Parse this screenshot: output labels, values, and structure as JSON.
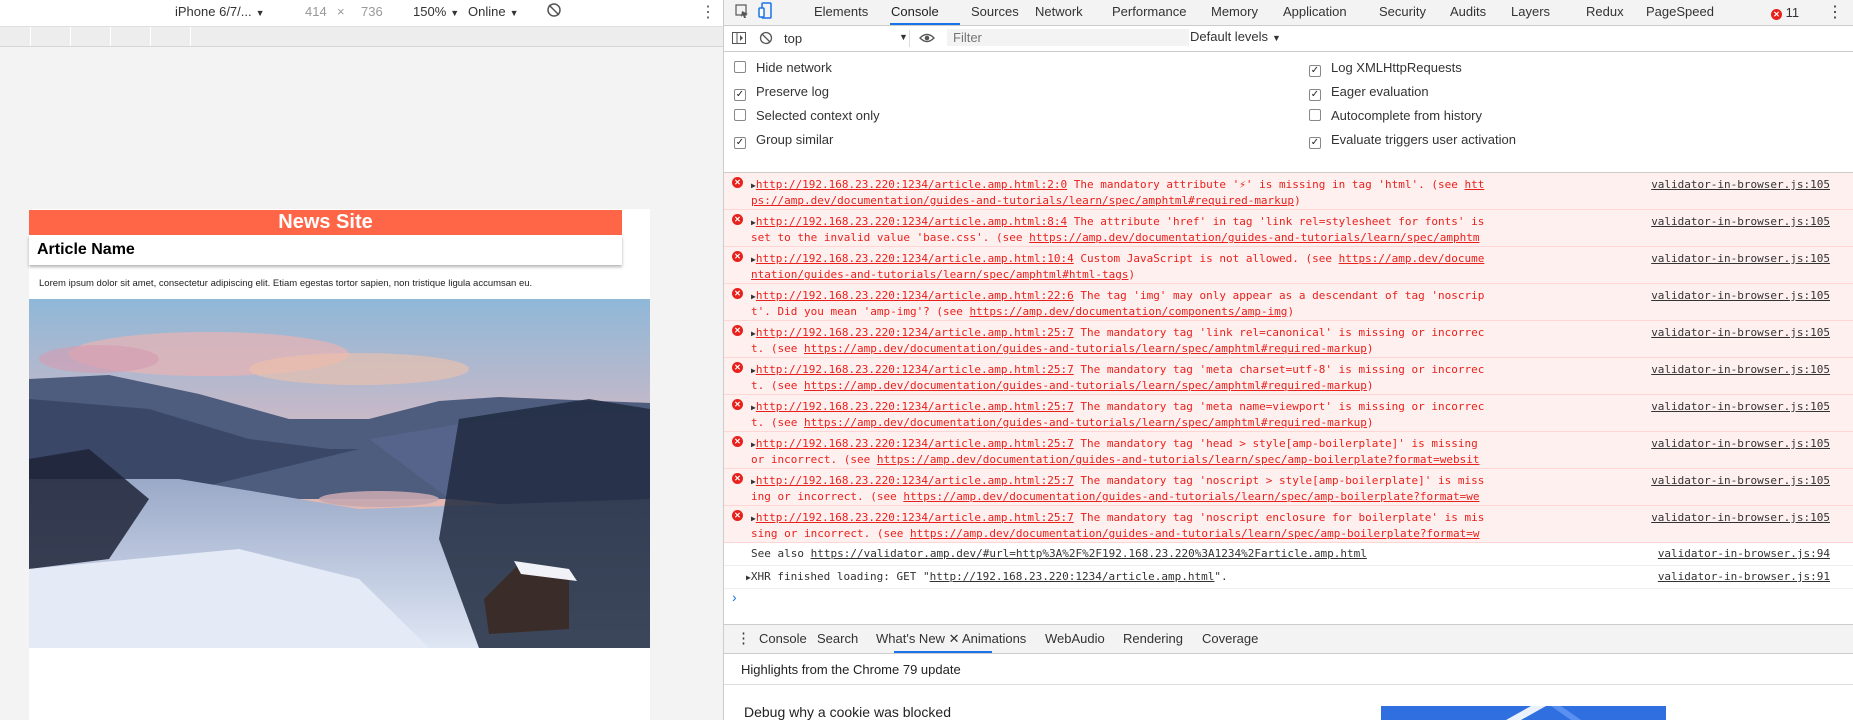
{
  "device_toolbar": {
    "device": "iPhone 6/7/...",
    "width": "414",
    "times": "×",
    "height": "736",
    "zoom": "150%",
    "network": "Online"
  },
  "page": {
    "site_title": "News Site",
    "article_name": "Article Name",
    "lorem": "Lorem ipsum dolor sit amet, consectetur adipiscing elit. Etiam egestas tortor sapien, non tristique ligula accumsan eu."
  },
  "devtools": {
    "tabs": [
      "Elements",
      "Console",
      "Sources",
      "Network",
      "Performance",
      "Memory",
      "Application",
      "Security",
      "Audits",
      "Layers",
      "Redux",
      "PageSpeed"
    ],
    "active_tab": "Console",
    "error_count": "11",
    "context": "top",
    "filter_placeholder": "Filter",
    "levels": "Default levels",
    "settings": [
      {
        "label": "Hide network",
        "checked": false
      },
      {
        "label": "Preserve log",
        "checked": true
      },
      {
        "label": "Selected context only",
        "checked": false
      },
      {
        "label": "Group similar",
        "checked": true
      },
      {
        "label": "Log XMLHttpRequests",
        "checked": true
      },
      {
        "label": "Eager evaluation",
        "checked": true
      },
      {
        "label": "Autocomplete from history",
        "checked": false
      },
      {
        "label": "Evaluate triggers user activation",
        "checked": true
      }
    ],
    "errors": [
      {
        "loc": "http://192.168.23.220:1234/article.amp.html:2:0",
        "text": " The mandatory attribute '⚡' is missing in tag 'html'. (see ",
        "url": "https://amp.dev/documentation/guides-and-tutorials/learn/spec/amphtml#required-markup",
        "end": ")",
        "src": "validator-in-browser.js:105"
      },
      {
        "loc": "http://192.168.23.220:1234/article.amp.html:8:4",
        "text": " The attribute 'href' in tag 'link rel=stylesheet for fonts' is set to the invalid value 'base.css'. (see ",
        "url": "https://amp.dev/documentation/guides-and-tutorials/learn/spec/amphtml#custom-fonts",
        "end": ")",
        "src": "validator-in-browser.js:105"
      },
      {
        "loc": "http://192.168.23.220:1234/article.amp.html:10:4",
        "text": " Custom JavaScript is not allowed. (see ",
        "url": "https://amp.dev/documentation/guides-and-tutorials/learn/spec/amphtml#html-tags",
        "end": ")",
        "src": "validator-in-browser.js:105"
      },
      {
        "loc": "http://192.168.23.220:1234/article.amp.html:22:6",
        "text": " The tag 'img' may only appear as a descendant of tag 'noscript'. Did you mean 'amp-img'? (see ",
        "url": "https://amp.dev/documentation/components/amp-img",
        "end": ")",
        "src": "validator-in-browser.js:105"
      },
      {
        "loc": "http://192.168.23.220:1234/article.amp.html:25:7",
        "text": " The mandatory tag 'link rel=canonical' is missing or incorrect. (see ",
        "url": "https://amp.dev/documentation/guides-and-tutorials/learn/spec/amphtml#required-markup",
        "end": ")",
        "src": "validator-in-browser.js:105"
      },
      {
        "loc": "http://192.168.23.220:1234/article.amp.html:25:7",
        "text": " The mandatory tag 'meta charset=utf-8' is missing or incorrect. (see ",
        "url": "https://amp.dev/documentation/guides-and-tutorials/learn/spec/amphtml#required-markup",
        "end": ")",
        "src": "validator-in-browser.js:105"
      },
      {
        "loc": "http://192.168.23.220:1234/article.amp.html:25:7",
        "text": " The mandatory tag 'meta name=viewport' is missing or incorrect. (see ",
        "url": "https://amp.dev/documentation/guides-and-tutorials/learn/spec/amphtml#required-markup",
        "end": ")",
        "src": "validator-in-browser.js:105"
      },
      {
        "loc": "http://192.168.23.220:1234/article.amp.html:25:7",
        "text": " The mandatory tag 'head > style[amp-boilerplate]' is missing or incorrect. (see ",
        "url": "https://amp.dev/documentation/guides-and-tutorials/learn/spec/amp-boilerplate?format=websites",
        "end": ")",
        "src": "validator-in-browser.js:105"
      },
      {
        "loc": "http://192.168.23.220:1234/article.amp.html:25:7",
        "text": " The mandatory tag 'noscript > style[amp-boilerplate]' is missing or incorrect. (see ",
        "url": "https://amp.dev/documentation/guides-and-tutorials/learn/spec/amp-boilerplate?format=websites",
        "end": ")",
        "src": "validator-in-browser.js:105"
      },
      {
        "loc": "http://192.168.23.220:1234/article.amp.html:25:7",
        "text": " The mandatory tag 'noscript enclosure for boilerplate' is missing or incorrect. (see ",
        "url": "https://amp.dev/documentation/guides-and-tutorials/learn/spec/amp-boilerplate?format=websites",
        "end": ")",
        "src": "validator-in-browser.js:105"
      }
    ],
    "see_also": {
      "prefix": "See also ",
      "url": "https://validator.amp.dev/#url=http%3A%2F%2F192.168.23.220%3A1234%2Farticle.amp.html",
      "src": "validator-in-browser.js:94"
    },
    "xhr": {
      "prefix": "XHR finished loading: GET \"",
      "url": "http://192.168.23.220:1234/article.amp.html",
      "suffix": "\".",
      "src": "validator-in-browser.js:91"
    },
    "drawer_tabs": [
      "Console",
      "Search",
      "What's New",
      "Animations",
      "WebAudio",
      "Rendering",
      "Coverage"
    ],
    "drawer_active": "What's New",
    "drawer_headline": "Highlights from the Chrome 79 update",
    "drawer_item": "Debug why a cookie was blocked"
  },
  "colors": {
    "header": "#ff6647",
    "error": "#e8211c",
    "accent": "#1a73e8"
  }
}
